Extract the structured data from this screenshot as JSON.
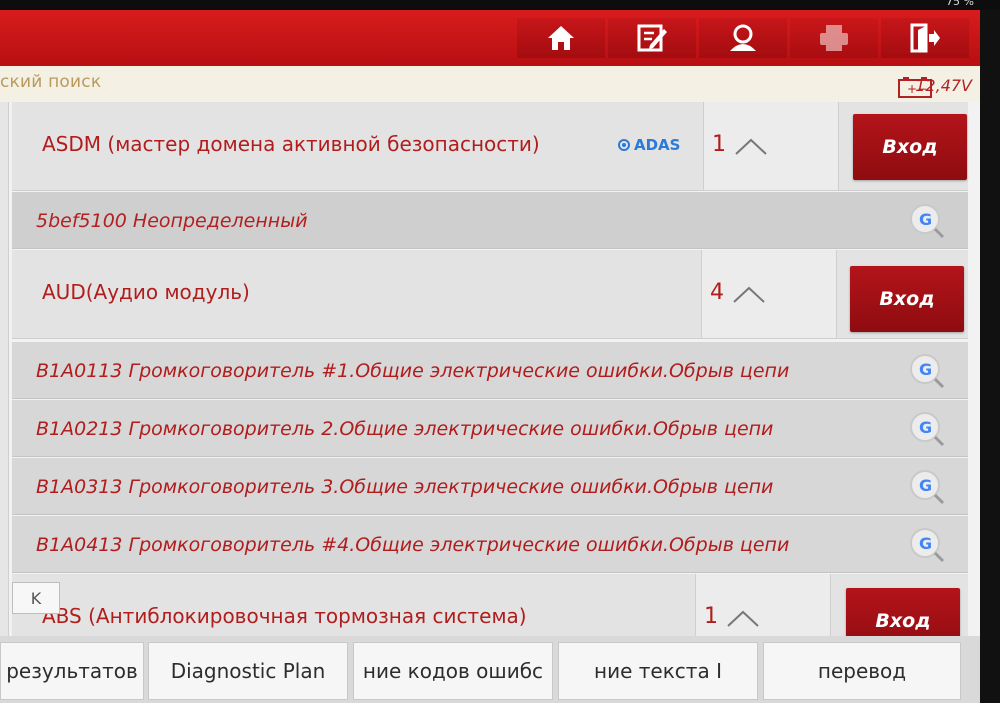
{
  "status_bar": {
    "battery_percent": "75 %"
  },
  "header": {
    "buttons": [
      {
        "name": "home-icon"
      },
      {
        "name": "edit-report-icon"
      },
      {
        "name": "user-icon"
      },
      {
        "name": "printer-icon"
      },
      {
        "name": "exit-icon"
      }
    ]
  },
  "subheader": {
    "search_label": "ский поиск",
    "voltage": "12,47V"
  },
  "modules": [
    {
      "name": "ASDM (мастер домена активной безопасности)",
      "badge": "ADAS",
      "count": "1",
      "enter_label": "Вход",
      "codes": [
        {
          "text": "5bef5100 Неопределенный"
        }
      ]
    },
    {
      "name": "AUD(Аудио модуль)",
      "count": "4",
      "enter_label": "Вход",
      "codes": [
        {
          "text": "B1A0113 Громкоговоритель #1.Общие электрические ошибки.Обрыв цепи"
        },
        {
          "text": "B1A0213 Громкоговоритель 2.Общие электрические ошибки.Обрыв цепи"
        },
        {
          "text": "B1A0313 Громкоговоритель 3.Общие электрические ошибки.Обрыв цепи"
        },
        {
          "text": "B1A0413 Громкоговоритель #4.Общие электрические ошибки.Обрыв цепи"
        }
      ]
    },
    {
      "name": "ABS (Антиблокировочная тормозная система)",
      "count": "1",
      "enter_label": "Вход"
    }
  ],
  "collapse_label": "K",
  "bottom_bar": {
    "buttons": [
      {
        "label": "результатов"
      },
      {
        "label": "Diagnostic Plan"
      },
      {
        "label": "ние кодов ошибс"
      },
      {
        "label": "ние текста      I"
      },
      {
        "label": "перевод"
      }
    ]
  },
  "colors": {
    "header_red": "#c7161a",
    "enter_button": "#a30f14",
    "code_text": "#b11d1d",
    "adas_blue": "#2b7ad8"
  }
}
